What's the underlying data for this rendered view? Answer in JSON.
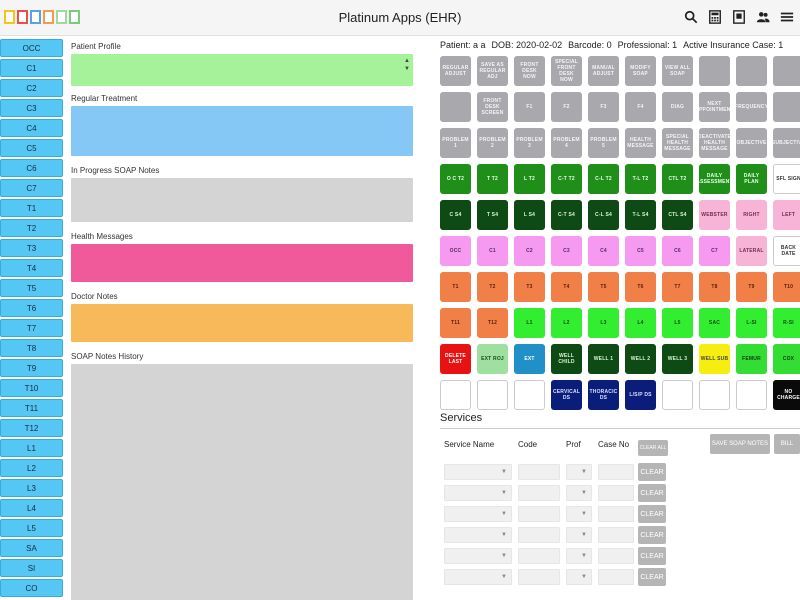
{
  "header": {
    "title": "Platinum Apps (EHR)",
    "swatch_colors": [
      "#f5c518",
      "#e94f4f",
      "#5aa0e6",
      "#f59a4f",
      "#a0d8a0",
      "#7acb7a"
    ],
    "icons": [
      "search-icon",
      "calculator-icon",
      "book-icon",
      "users-icon",
      "menu-icon"
    ]
  },
  "sidebar": {
    "items": [
      "OCC",
      "C1",
      "C2",
      "C3",
      "C4",
      "C5",
      "C6",
      "C7",
      "T1",
      "T2",
      "T3",
      "T4",
      "T5",
      "T6",
      "T7",
      "T8",
      "T9",
      "T10",
      "T11",
      "T12",
      "L1",
      "L2",
      "L3",
      "L4",
      "L5",
      "SA",
      "SI",
      "CO"
    ]
  },
  "sections": [
    {
      "label": "Patient Profile",
      "color": "#a6f29a"
    },
    {
      "label": "Regular Treatment",
      "color": "#86c8f5"
    },
    {
      "label": "In Progress SOAP Notes",
      "color": "#d4d4d4"
    },
    {
      "label": "Health Messages",
      "color": "#f05a9a"
    },
    {
      "label": "Doctor Notes",
      "color": "#f7b95a"
    },
    {
      "label": "SOAP Notes History",
      "color": "#d4d4d4"
    }
  ],
  "patient": {
    "name": "Patient: a a",
    "dob": "DOB: 2020-02-02",
    "barcode": "Barcode: 0",
    "professional": "Professional: 1",
    "insurance": "Active Insurance Case: 1"
  },
  "grid": [
    [
      {
        "l": "REGULAR ADJUST",
        "c": "gray"
      },
      {
        "l": "SAVE AS REGULAR ADJ",
        "c": "gray"
      },
      {
        "l": "FRONT DESK NOW",
        "c": "gray"
      },
      {
        "l": "SPECIAL FRONT DESK NOW",
        "c": "gray"
      },
      {
        "l": "MANUAL ADJUST",
        "c": "gray"
      },
      {
        "l": "MODIFY SOAP",
        "c": "gray"
      },
      {
        "l": "VIEW ALL SOAP",
        "c": "gray"
      },
      {
        "l": "",
        "c": "gray"
      },
      {
        "l": "",
        "c": "gray"
      },
      {
        "l": "",
        "c": "gray"
      }
    ],
    [
      {
        "l": "",
        "c": "gray"
      },
      {
        "l": "FRONT DESK SCREEN",
        "c": "gray"
      },
      {
        "l": "F1",
        "c": "gray"
      },
      {
        "l": "F2",
        "c": "gray"
      },
      {
        "l": "F3",
        "c": "gray"
      },
      {
        "l": "F4",
        "c": "gray"
      },
      {
        "l": "DIAG",
        "c": "gray"
      },
      {
        "l": "NEXT APPOINTMENT",
        "c": "gray"
      },
      {
        "l": "FREQUENCY",
        "c": "gray"
      },
      {
        "l": "",
        "c": "gray"
      }
    ],
    [
      {
        "l": "PROBLEM 1",
        "c": "gray"
      },
      {
        "l": "PROBLEM 2",
        "c": "gray"
      },
      {
        "l": "PROBLEM 3",
        "c": "gray"
      },
      {
        "l": "PROBLEM 4",
        "c": "gray"
      },
      {
        "l": "PROBLEM 5",
        "c": "gray"
      },
      {
        "l": "HEALTH MESSAGE",
        "c": "gray"
      },
      {
        "l": "SPECIAL HEALTH MESSAGE",
        "c": "gray"
      },
      {
        "l": "DEACTIVATE HEALTH MESSAGE",
        "c": "gray"
      },
      {
        "l": "OBJECTIVE",
        "c": "gray"
      },
      {
        "l": "SUBJECTIVE",
        "c": "gray"
      }
    ],
    [
      {
        "l": "O C T2",
        "c": "dgreen"
      },
      {
        "l": "T T2",
        "c": "dgreen"
      },
      {
        "l": "L T2",
        "c": "dgreen"
      },
      {
        "l": "C-T T2",
        "c": "dgreen"
      },
      {
        "l": "C-L T2",
        "c": "dgreen"
      },
      {
        "l": "T-L T2",
        "c": "dgreen"
      },
      {
        "l": "CTL T2",
        "c": "dgreen"
      },
      {
        "l": "DAILY ASSESSMENT",
        "c": "dgreen"
      },
      {
        "l": "DAILY PLAN",
        "c": "dgreen"
      },
      {
        "l": "SFL SIGN",
        "c": "white"
      }
    ],
    [
      {
        "l": "C S4",
        "c": "vdgreen"
      },
      {
        "l": "T S4",
        "c": "vdgreen"
      },
      {
        "l": "L S4",
        "c": "vdgreen"
      },
      {
        "l": "C-T S4",
        "c": "vdgreen"
      },
      {
        "l": "C-L S4",
        "c": "vdgreen"
      },
      {
        "l": "T-L S4",
        "c": "vdgreen"
      },
      {
        "l": "CTL S4",
        "c": "vdgreen"
      },
      {
        "l": "WEBSTER",
        "c": "lpink"
      },
      {
        "l": "RIGHT",
        "c": "lpink"
      },
      {
        "l": "LEFT",
        "c": "lpink"
      }
    ],
    [
      {
        "l": "OCC",
        "c": "pink"
      },
      {
        "l": "C1",
        "c": "pink"
      },
      {
        "l": "C2",
        "c": "pink"
      },
      {
        "l": "C3",
        "c": "pink"
      },
      {
        "l": "C4",
        "c": "pink"
      },
      {
        "l": "C5",
        "c": "pink"
      },
      {
        "l": "C6",
        "c": "pink"
      },
      {
        "l": "C7",
        "c": "pink"
      },
      {
        "l": "LATERAL",
        "c": "lpink"
      },
      {
        "l": "BACK DATE",
        "c": "white"
      }
    ],
    [
      {
        "l": "T1",
        "c": "orange"
      },
      {
        "l": "T2",
        "c": "orange"
      },
      {
        "l": "T3",
        "c": "orange"
      },
      {
        "l": "T4",
        "c": "orange"
      },
      {
        "l": "T5",
        "c": "orange"
      },
      {
        "l": "T6",
        "c": "orange"
      },
      {
        "l": "T7",
        "c": "orange"
      },
      {
        "l": "T8",
        "c": "orange"
      },
      {
        "l": "T9",
        "c": "orange"
      },
      {
        "l": "T10",
        "c": "orange"
      }
    ],
    [
      {
        "l": "T11",
        "c": "orange"
      },
      {
        "l": "T12",
        "c": "orange"
      },
      {
        "l": "L1",
        "c": "lime"
      },
      {
        "l": "L2",
        "c": "lime"
      },
      {
        "l": "L3",
        "c": "lime"
      },
      {
        "l": "L4",
        "c": "lime"
      },
      {
        "l": "L5",
        "c": "lime"
      },
      {
        "l": "SAC",
        "c": "lime"
      },
      {
        "l": "L-SI",
        "c": "lime"
      },
      {
        "l": "R-SI",
        "c": "lime"
      }
    ],
    [
      {
        "l": "DELETE LAST",
        "c": "red"
      },
      {
        "l": "EXT ROJ",
        "c": "lgreen"
      },
      {
        "l": "EXT",
        "c": "blue"
      },
      {
        "l": "WELL CHILD",
        "c": "vdgreen"
      },
      {
        "l": "WELL 1",
        "c": "vdgreen"
      },
      {
        "l": "WELL 2",
        "c": "vdgreen"
      },
      {
        "l": "WELL 3",
        "c": "vdgreen"
      },
      {
        "l": "WELL SUB",
        "c": "yellow"
      },
      {
        "l": "FEMUR",
        "c": "bgreen"
      },
      {
        "l": "COX",
        "c": "bgreen"
      }
    ],
    [
      {
        "l": "",
        "c": "white"
      },
      {
        "l": "",
        "c": "white"
      },
      {
        "l": "",
        "c": "white"
      },
      {
        "l": "CERVICAL DS",
        "c": "navy"
      },
      {
        "l": "THORACIC DS",
        "c": "navy"
      },
      {
        "l": "L/S/P DS",
        "c": "navy"
      },
      {
        "l": "",
        "c": "white"
      },
      {
        "l": "",
        "c": "white"
      },
      {
        "l": "",
        "c": "white"
      },
      {
        "l": "NO CHARGE",
        "c": "black"
      }
    ]
  ],
  "services": {
    "title": "Services",
    "headers": {
      "name": "Service Name",
      "code": "Code",
      "prof": "Prof",
      "case": "Case No"
    },
    "clear_all": "CLEAR ALL",
    "save_soap": "SAVE SOAP NOTES",
    "bill": "BILL",
    "row_clear": "CLEAR",
    "row_count": 6
  }
}
